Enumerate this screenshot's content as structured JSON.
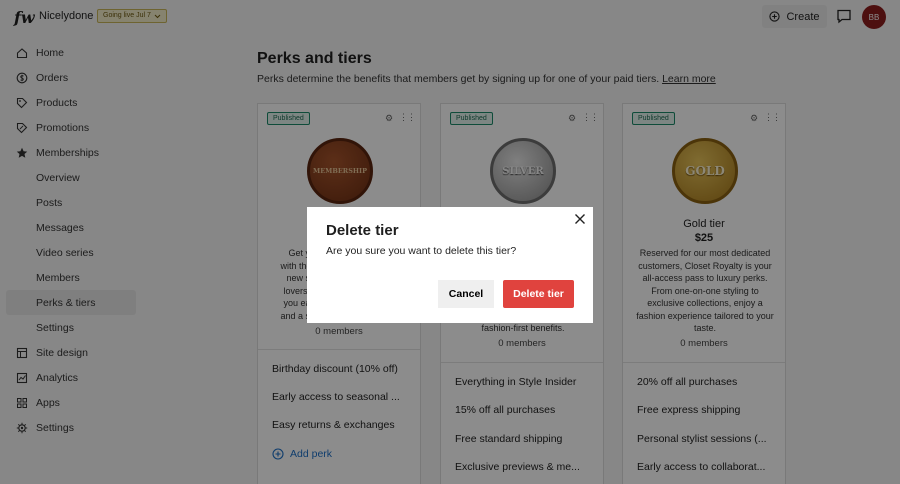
{
  "topbar": {
    "logo": "fw",
    "site_name": "Nicelydone",
    "go_live": "Going live Jul 7",
    "create_label": "Create",
    "avatar_initials": "BB"
  },
  "sidebar": {
    "items": [
      {
        "label": "Home",
        "icon": "home-icon"
      },
      {
        "label": "Orders",
        "icon": "dollar-icon"
      },
      {
        "label": "Products",
        "icon": "tag-icon"
      },
      {
        "label": "Promotions",
        "icon": "promo-icon"
      },
      {
        "label": "Memberships",
        "icon": "star-icon"
      },
      {
        "label": "Overview"
      },
      {
        "label": "Posts"
      },
      {
        "label": "Messages"
      },
      {
        "label": "Video series"
      },
      {
        "label": "Members"
      },
      {
        "label": "Perks & tiers",
        "active": true
      },
      {
        "label": "Settings"
      },
      {
        "label": "Site design",
        "icon": "layout-icon"
      },
      {
        "label": "Analytics",
        "icon": "chart-icon"
      },
      {
        "label": "Apps",
        "icon": "grid-icon"
      },
      {
        "label": "Settings",
        "icon": "gear-icon"
      }
    ]
  },
  "main": {
    "title": "Perks and tiers",
    "subtitle": "Perks determine the benefits that members get by signing up for one of your paid tiers.",
    "learn_more": "Learn more"
  },
  "tiers": [
    {
      "badge": "Published",
      "medal_text": "MEMBERSHIP",
      "desc_lines": [
        "Get you",
        "with the S",
        "new sho",
        "lovers, th",
        "you early",
        "and a spe"
      ],
      "members": "0 members",
      "perks": [
        "Birthday discount (10% off)",
        "Early access to seasonal ...",
        "Easy returns & exchanges"
      ],
      "add_perk": "Add perk"
    },
    {
      "badge": "Published",
      "medal_text": "SILVER",
      "desc_lines": [
        "fashion-first benefits."
      ],
      "members": "0 members",
      "perks": [
        "Everything in Style Insider",
        "15% off all purchases",
        "Free standard shipping",
        "Exclusive previews & me..."
      ]
    },
    {
      "badge": "Published",
      "medal_text": "GOLD",
      "name": "Gold tier",
      "price": "$25",
      "desc_lines": [
        "Reserved for our most dedicated",
        "customers, Closet Royalty is your",
        "all-access pass to luxury perks.",
        "From one-on-one styling to",
        "exclusive collections, enjoy a",
        "fashion experience tailored to your",
        "taste."
      ],
      "members": "0 members",
      "perks": [
        "20% off all purchases",
        "Free express shipping",
        "Personal stylist sessions (...",
        "Early access to collaborat..."
      ]
    }
  ],
  "modal": {
    "title": "Delete tier",
    "text": "Are you sure you want to delete this tier?",
    "cancel": "Cancel",
    "confirm": "Delete tier"
  },
  "colors": {
    "delete": "#e0433e",
    "published": "#1c8a6b",
    "link": "#1d6fc6"
  }
}
